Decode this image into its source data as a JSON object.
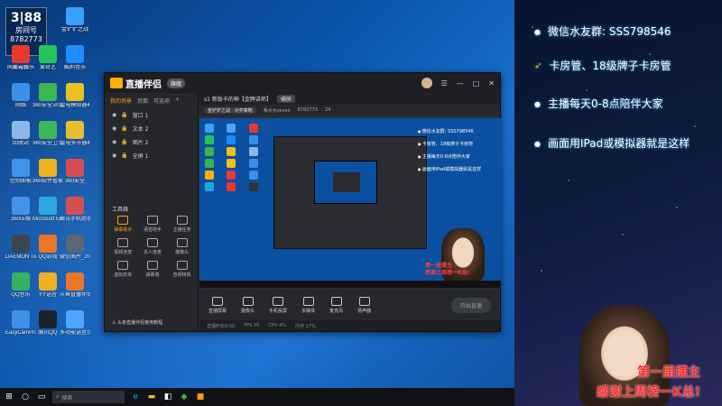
{
  "desktop": {
    "room": {
      "label": "房间号",
      "number": "8782773"
    },
    "icons": [
      {
        "label": "金铲铲之战",
        "color": "#3aa0ff"
      },
      {
        "label": "此电脑",
        "color": "#4da3ff"
      },
      {
        "label": "网易云音乐",
        "color": "#e8392c"
      },
      {
        "label": "爱奇艺",
        "color": "#24c45c"
      },
      {
        "label": "酷狗音乐",
        "color": "#1c8cff"
      },
      {
        "label": "网络",
        "color": "#3a8ee6"
      },
      {
        "label": "360安全浏览器",
        "color": "#3ab54a"
      },
      {
        "label": "雷电模拟器4",
        "color": "#f2c014"
      },
      {
        "label": "回收站",
        "color": "#8fb7e6"
      },
      {
        "label": "360安全卫士",
        "color": "#3ab54a"
      },
      {
        "label": "雷电多开器4",
        "color": "#f2c014"
      },
      {
        "label": "控制面板",
        "color": "#3a8ee6"
      },
      {
        "label": "360软件管家",
        "color": "#ffb100"
      },
      {
        "label": "360安全",
        "color": "#e83a3a"
      },
      {
        "label": "360压缩",
        "color": "#3a8ee6"
      },
      {
        "label": "Microsoft Edge",
        "color": "#1fa6d8"
      },
      {
        "label": "腾讯手机助手",
        "color": "#e8392c"
      },
      {
        "label": "DAEMON Tools Lite",
        "color": "#333"
      },
      {
        "label": "QQ游戏",
        "color": "#ff6a00"
      },
      {
        "label": "微信图片_2021091...",
        "color": "#555"
      },
      {
        "label": "QQ音乐",
        "color": "#2bb24c"
      },
      {
        "label": "YY语音",
        "color": "#ffb100"
      },
      {
        "label": "斗鱼直播伴侣",
        "color": "#ff6a00"
      },
      {
        "label": "EasyCamPro机神",
        "color": "#3a8ee6"
      },
      {
        "label": "腾讯QQ",
        "color": "#111"
      },
      {
        "label": "多功能语音计算器",
        "color": "#4da3ff"
      }
    ]
  },
  "app": {
    "name": "直播伴侣",
    "version": "旗舰",
    "left_tabs": [
      "我的场景",
      "页面",
      "可选项"
    ],
    "sources": [
      "窗口 1",
      "文本 2",
      "图片 2",
      "全屏 1"
    ],
    "tools_title": "工具箱",
    "tools": [
      {
        "label": "弹幕助手",
        "hot": true
      },
      {
        "label": "语音助手",
        "hot": false
      },
      {
        "label": "主播任务",
        "hot": false
      },
      {
        "label": "视频连麦",
        "hot": false
      },
      {
        "label": "多人连麦",
        "hot": false
      },
      {
        "label": "摄像头",
        "hot": false
      },
      {
        "label": "虚拟形象",
        "hot": false
      },
      {
        "label": "弹幕墙",
        "hot": false
      },
      {
        "label": "音频特效",
        "hot": false
      }
    ],
    "tip": "⚠ 头条直播伴侣使用教程",
    "scene_bar": {
      "scene": "s1 新版卡的神【金牌讲师】",
      "tag": "横屏"
    },
    "stream_info": {
      "category": "金铲铲之战 · 对弈策略",
      "host": "我大大seven",
      "room": "8782773",
      "viewers": "24"
    },
    "preview_text": [
      "微信水友群: SSS798546",
      "卡房管、18级牌子卡房管",
      "主播每天0-8点陪伴大家",
      "画面用iPad或模拟器就是这样"
    ],
    "preview_red": [
      "第一届擂主",
      "感谢上周榜一K总!"
    ],
    "bottom_buttons": [
      "直播屏幕",
      "摄像头",
      "手机投屏",
      "多媒体",
      "麦克风",
      "扬声器"
    ],
    "go_live": "开始直播",
    "status": [
      "直播时长0:00",
      "FPS 30",
      "CPU 4%",
      "内存 17%"
    ]
  },
  "overlay": {
    "lines": [
      {
        "text": "微信水友群:  SSS798546",
        "style": "dot"
      },
      {
        "text": "卡房管、18级牌子卡房管",
        "style": "rocket"
      },
      {
        "text": "主播每天0-8点陪伴大家",
        "style": "dot"
      },
      {
        "text": "画面用IPad或模拟器就是这样",
        "style": "dot"
      }
    ],
    "red_text": [
      "第一届擂主",
      "感谢上周榜一K总!"
    ]
  },
  "taskbar": {
    "search_placeholder": "搜索",
    "right_text": ""
  }
}
